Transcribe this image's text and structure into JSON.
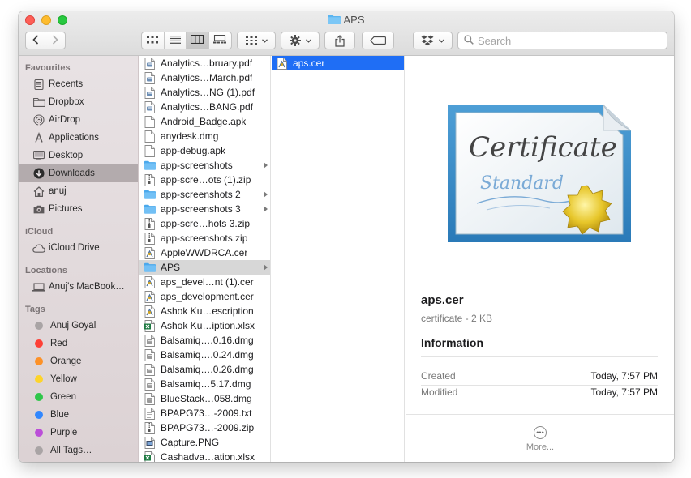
{
  "window": {
    "title": "APS",
    "folder_icon": "folder-icon"
  },
  "toolbar": {
    "back_icon": "chevron-left-icon",
    "forward_icon": "chevron-right-icon",
    "view_modes": [
      "icon-view",
      "list-view",
      "column-view",
      "gallery-view"
    ],
    "active_view": "column-view",
    "group_icon": "group-grid-icon",
    "action_icon": "gear-icon",
    "share_icon": "share-icon",
    "tag_icon": "tag-icon",
    "dropbox_icon": "dropbox-icon",
    "search_placeholder": "Search"
  },
  "sidebar": {
    "sections": [
      {
        "title": "Favourites",
        "items": [
          {
            "label": "Recents",
            "icon": "recents-icon"
          },
          {
            "label": "Dropbox",
            "icon": "folder-icon"
          },
          {
            "label": "AirDrop",
            "icon": "airdrop-icon"
          },
          {
            "label": "Applications",
            "icon": "applications-icon"
          },
          {
            "label": "Desktop",
            "icon": "desktop-icon"
          },
          {
            "label": "Downloads",
            "icon": "downloads-icon",
            "selected": true
          },
          {
            "label": "anuj",
            "icon": "home-icon"
          },
          {
            "label": "Pictures",
            "icon": "camera-icon"
          }
        ]
      },
      {
        "title": "iCloud",
        "items": [
          {
            "label": "iCloud Drive",
            "icon": "cloud-icon"
          }
        ]
      },
      {
        "title": "Locations",
        "items": [
          {
            "label": "Anuj’s MacBook…",
            "icon": "laptop-icon"
          }
        ]
      },
      {
        "title": "Tags",
        "items": [
          {
            "label": "Anuj Goyal",
            "tag_color": "#a9a4a5"
          },
          {
            "label": "Red",
            "tag_color": "#fe4036"
          },
          {
            "label": "Orange",
            "tag_color": "#fd9127"
          },
          {
            "label": "Yellow",
            "tag_color": "#fdd42b"
          },
          {
            "label": "Green",
            "tag_color": "#2fc64a"
          },
          {
            "label": "Blue",
            "tag_color": "#3187fe"
          },
          {
            "label": "Purple",
            "tag_color": "#bb4ed8"
          },
          {
            "label": "All Tags…",
            "tag_color": "#a9a4a5"
          }
        ]
      }
    ]
  },
  "column1": {
    "items": [
      {
        "name": "Analytics…bruary.pdf",
        "type": "pdf"
      },
      {
        "name": "Analytics…March.pdf",
        "type": "pdf"
      },
      {
        "name": "Analytics…NG (1).pdf",
        "type": "pdf"
      },
      {
        "name": "Analytics…BANG.pdf",
        "type": "pdf"
      },
      {
        "name": "Android_Badge.apk",
        "type": "doc"
      },
      {
        "name": "anydesk.dmg",
        "type": "doc"
      },
      {
        "name": "app-debug.apk",
        "type": "doc"
      },
      {
        "name": "app-screenshots",
        "type": "folder",
        "arrow": true
      },
      {
        "name": "app-scre…ots (1).zip",
        "type": "zip"
      },
      {
        "name": "app-screenshots 2",
        "type": "folder",
        "arrow": true
      },
      {
        "name": "app-screenshots 3",
        "type": "folder",
        "arrow": true
      },
      {
        "name": "app-scre…hots 3.zip",
        "type": "zip"
      },
      {
        "name": "app-screenshots.zip",
        "type": "zip"
      },
      {
        "name": "AppleWWDRCA.cer",
        "type": "cer"
      },
      {
        "name": "APS",
        "type": "folder",
        "arrow": true,
        "highlighted": true
      },
      {
        "name": "aps_devel…nt (1).cer",
        "type": "cer"
      },
      {
        "name": "aps_development.cer",
        "type": "cer"
      },
      {
        "name": "Ashok Ku…escription",
        "type": "cer"
      },
      {
        "name": "Ashok Ku…iption.xlsx",
        "type": "xlsx"
      },
      {
        "name": "Balsamiq….0.16.dmg",
        "type": "dmg"
      },
      {
        "name": "Balsamiq….0.24.dmg",
        "type": "dmg"
      },
      {
        "name": "Balsamiq….0.26.dmg",
        "type": "dmg"
      },
      {
        "name": "Balsamiq…5.17.dmg",
        "type": "dmg"
      },
      {
        "name": "BlueStack…058.dmg",
        "type": "dmg"
      },
      {
        "name": "BPAPG73…-2009.txt",
        "type": "txt"
      },
      {
        "name": "BPAPG73…-2009.zip",
        "type": "zip"
      },
      {
        "name": "Capture.PNG",
        "type": "png"
      },
      {
        "name": "Cashadva…ation.xlsx",
        "type": "xlsx"
      }
    ]
  },
  "column2": {
    "items": [
      {
        "name": "aps.cer",
        "type": "cer",
        "selected": true
      }
    ]
  },
  "preview": {
    "image_icon": "certificate-standard-icon",
    "image_text_1": "Certificate",
    "image_text_2": "Standard",
    "name": "aps.cer",
    "kind": "certificate - 2 KB",
    "info_title": "Information",
    "rows": [
      {
        "key": "Created",
        "value": "Today, 7:57 PM"
      },
      {
        "key": "Modified",
        "value": "Today, 7:57 PM"
      }
    ],
    "more_label": "More..."
  }
}
